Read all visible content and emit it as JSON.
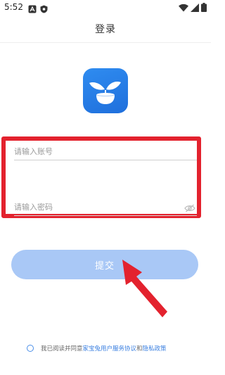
{
  "status_bar": {
    "time": "5:52"
  },
  "header": {
    "title": "登录"
  },
  "form": {
    "account_placeholder": "请输入账号",
    "password_placeholder": "请输入密码",
    "submit_label": "提交"
  },
  "agreement": {
    "prefix": "我已阅读并同意",
    "terms_link": "家宝兔用户服务协议",
    "and": "和",
    "privacy_link": "隐私政策"
  },
  "colors": {
    "accent": "#2f8cf0",
    "button_disabled": "#a9c8f6",
    "highlight": "#e3222e",
    "link": "#3a7fe0"
  },
  "icons": [
    "notification-a-icon",
    "shield-icon",
    "wifi-icon",
    "signal-icon",
    "battery-icon",
    "app-logo-icon",
    "eye-off-icon"
  ]
}
